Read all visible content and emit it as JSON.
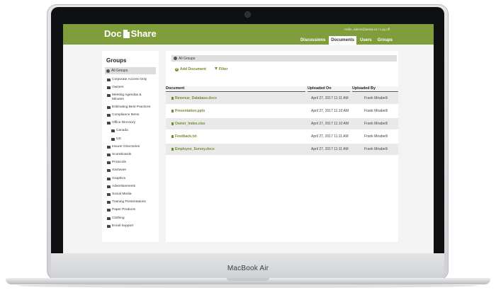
{
  "device": {
    "brand": "MacBook Air"
  },
  "app": {
    "logo_left": "Doc",
    "logo_right": "Share",
    "user_line": "Hello, admin@aesia.ca / Log off"
  },
  "nav": {
    "tabs": [
      "Discussions",
      "Documents",
      "Users",
      "Groups"
    ],
    "active": "Documents"
  },
  "sidebar": {
    "title": "Groups",
    "all_groups": "All Groups",
    "items": [
      {
        "label": "Corporate Access Only"
      },
      {
        "label": "Owners"
      },
      {
        "label": "Meeting Agendas & Minutes"
      },
      {
        "label": "Estimating Best Practices"
      },
      {
        "label": "Compliance Items"
      },
      {
        "label": "Office Directory"
      },
      {
        "label": "Canada"
      },
      {
        "label": "US"
      },
      {
        "label": "Insurer Directories"
      },
      {
        "label": "Scoreboards"
      },
      {
        "label": "Protocols"
      },
      {
        "label": "Xactware"
      },
      {
        "label": "Graphics"
      },
      {
        "label": "Advertisements"
      },
      {
        "label": "Social Media"
      },
      {
        "label": "Training Presentations"
      },
      {
        "label": "Paper Products"
      },
      {
        "label": "Clothing"
      },
      {
        "label": "Email Support"
      }
    ]
  },
  "main": {
    "breadcrumb": "All Groups",
    "add_document": "Add Document",
    "filter": "Filter",
    "columns": {
      "document": "Document",
      "uploaded_on": "Uploaded On",
      "uploaded_by": "Uploaded By"
    },
    "rows": [
      {
        "name": "Revenue_Database.docx",
        "date": "April 27, 2017 11:11 AM",
        "by": "Frank Mirabelli"
      },
      {
        "name": "Presentation.pptx",
        "date": "April 27, 2017 11:10 AM",
        "by": "Frank Mirabelli"
      },
      {
        "name": "Owner_Index.xlsx",
        "date": "April 27, 2017 11:10 AM",
        "by": "Frank Mirabelli"
      },
      {
        "name": "Feedback.txt",
        "date": "April 27, 2017 11:11 AM",
        "by": "Frank Mirabelli"
      },
      {
        "name": "Employee_Survey.docx",
        "date": "April 27, 2017 11:11 AM",
        "by": "Frank Mirabelli"
      }
    ]
  }
}
